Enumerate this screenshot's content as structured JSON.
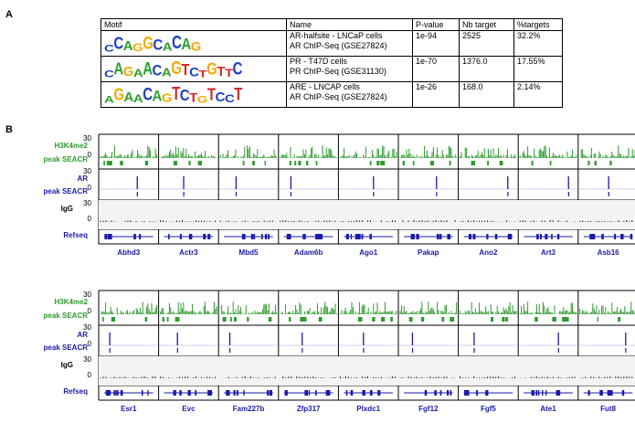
{
  "panels": {
    "a": "A",
    "b": "B"
  },
  "motif_table": {
    "headers": [
      "Motif",
      "Name",
      "P-value",
      "Nb target",
      "%targets"
    ],
    "rows": [
      {
        "logo": "CCAGGCACAG",
        "name_lines": [
          "AR-halfsite - LNCaP cells",
          "AR ChIP-Seq (GSE27824)"
        ],
        "pvalue": "1e-94",
        "nb_target": "2525",
        "pct": "32.2%"
      },
      {
        "logo": "CAGAACAGTCTGTTC",
        "name_lines": [
          "PR - T47D cells",
          "PR ChIP-Seq (GSE31130)"
        ],
        "pvalue": "1e-70",
        "nb_target": "1376.0",
        "pct": "17.55%"
      },
      {
        "logo": "AGAACAGTCTGTCCT",
        "name_lines": [
          "ARE - LNCAP cells",
          "AR ChIP-Seq (GSE27824)"
        ],
        "pvalue": "1e-26",
        "nb_target": "168.0",
        "pct": "2.14%"
      }
    ]
  },
  "colors": {
    "A": "#2ca02c",
    "C": "#1f3fbf",
    "G": "#f2a900",
    "T": "#d62728",
    "h3k4": "#2e9a2e",
    "ar": "#1a1aa8",
    "igg": "#111111",
    "gene": "#1a1aa8"
  },
  "track_labels": {
    "h3k4me2": "H3K4me2",
    "peak_seacr": "peak SEACR",
    "ar": "AR",
    "igg": "IgG",
    "refseq": "Refseq",
    "tick_30": "30",
    "tick_0": "0"
  },
  "blocks": [
    {
      "genes": [
        "Abhd3",
        "Actr3",
        "Mbd5",
        "Adam6b",
        "Ago1",
        "Pakap",
        "Ano2",
        "Art3",
        "Asb16"
      ]
    },
    {
      "genes": [
        "Esr1",
        "Evc",
        "Fam227b",
        "Zfp317",
        "Plxdc1",
        "Fgf12",
        "Fgf5",
        "Ate1",
        "Fut8"
      ]
    }
  ]
}
